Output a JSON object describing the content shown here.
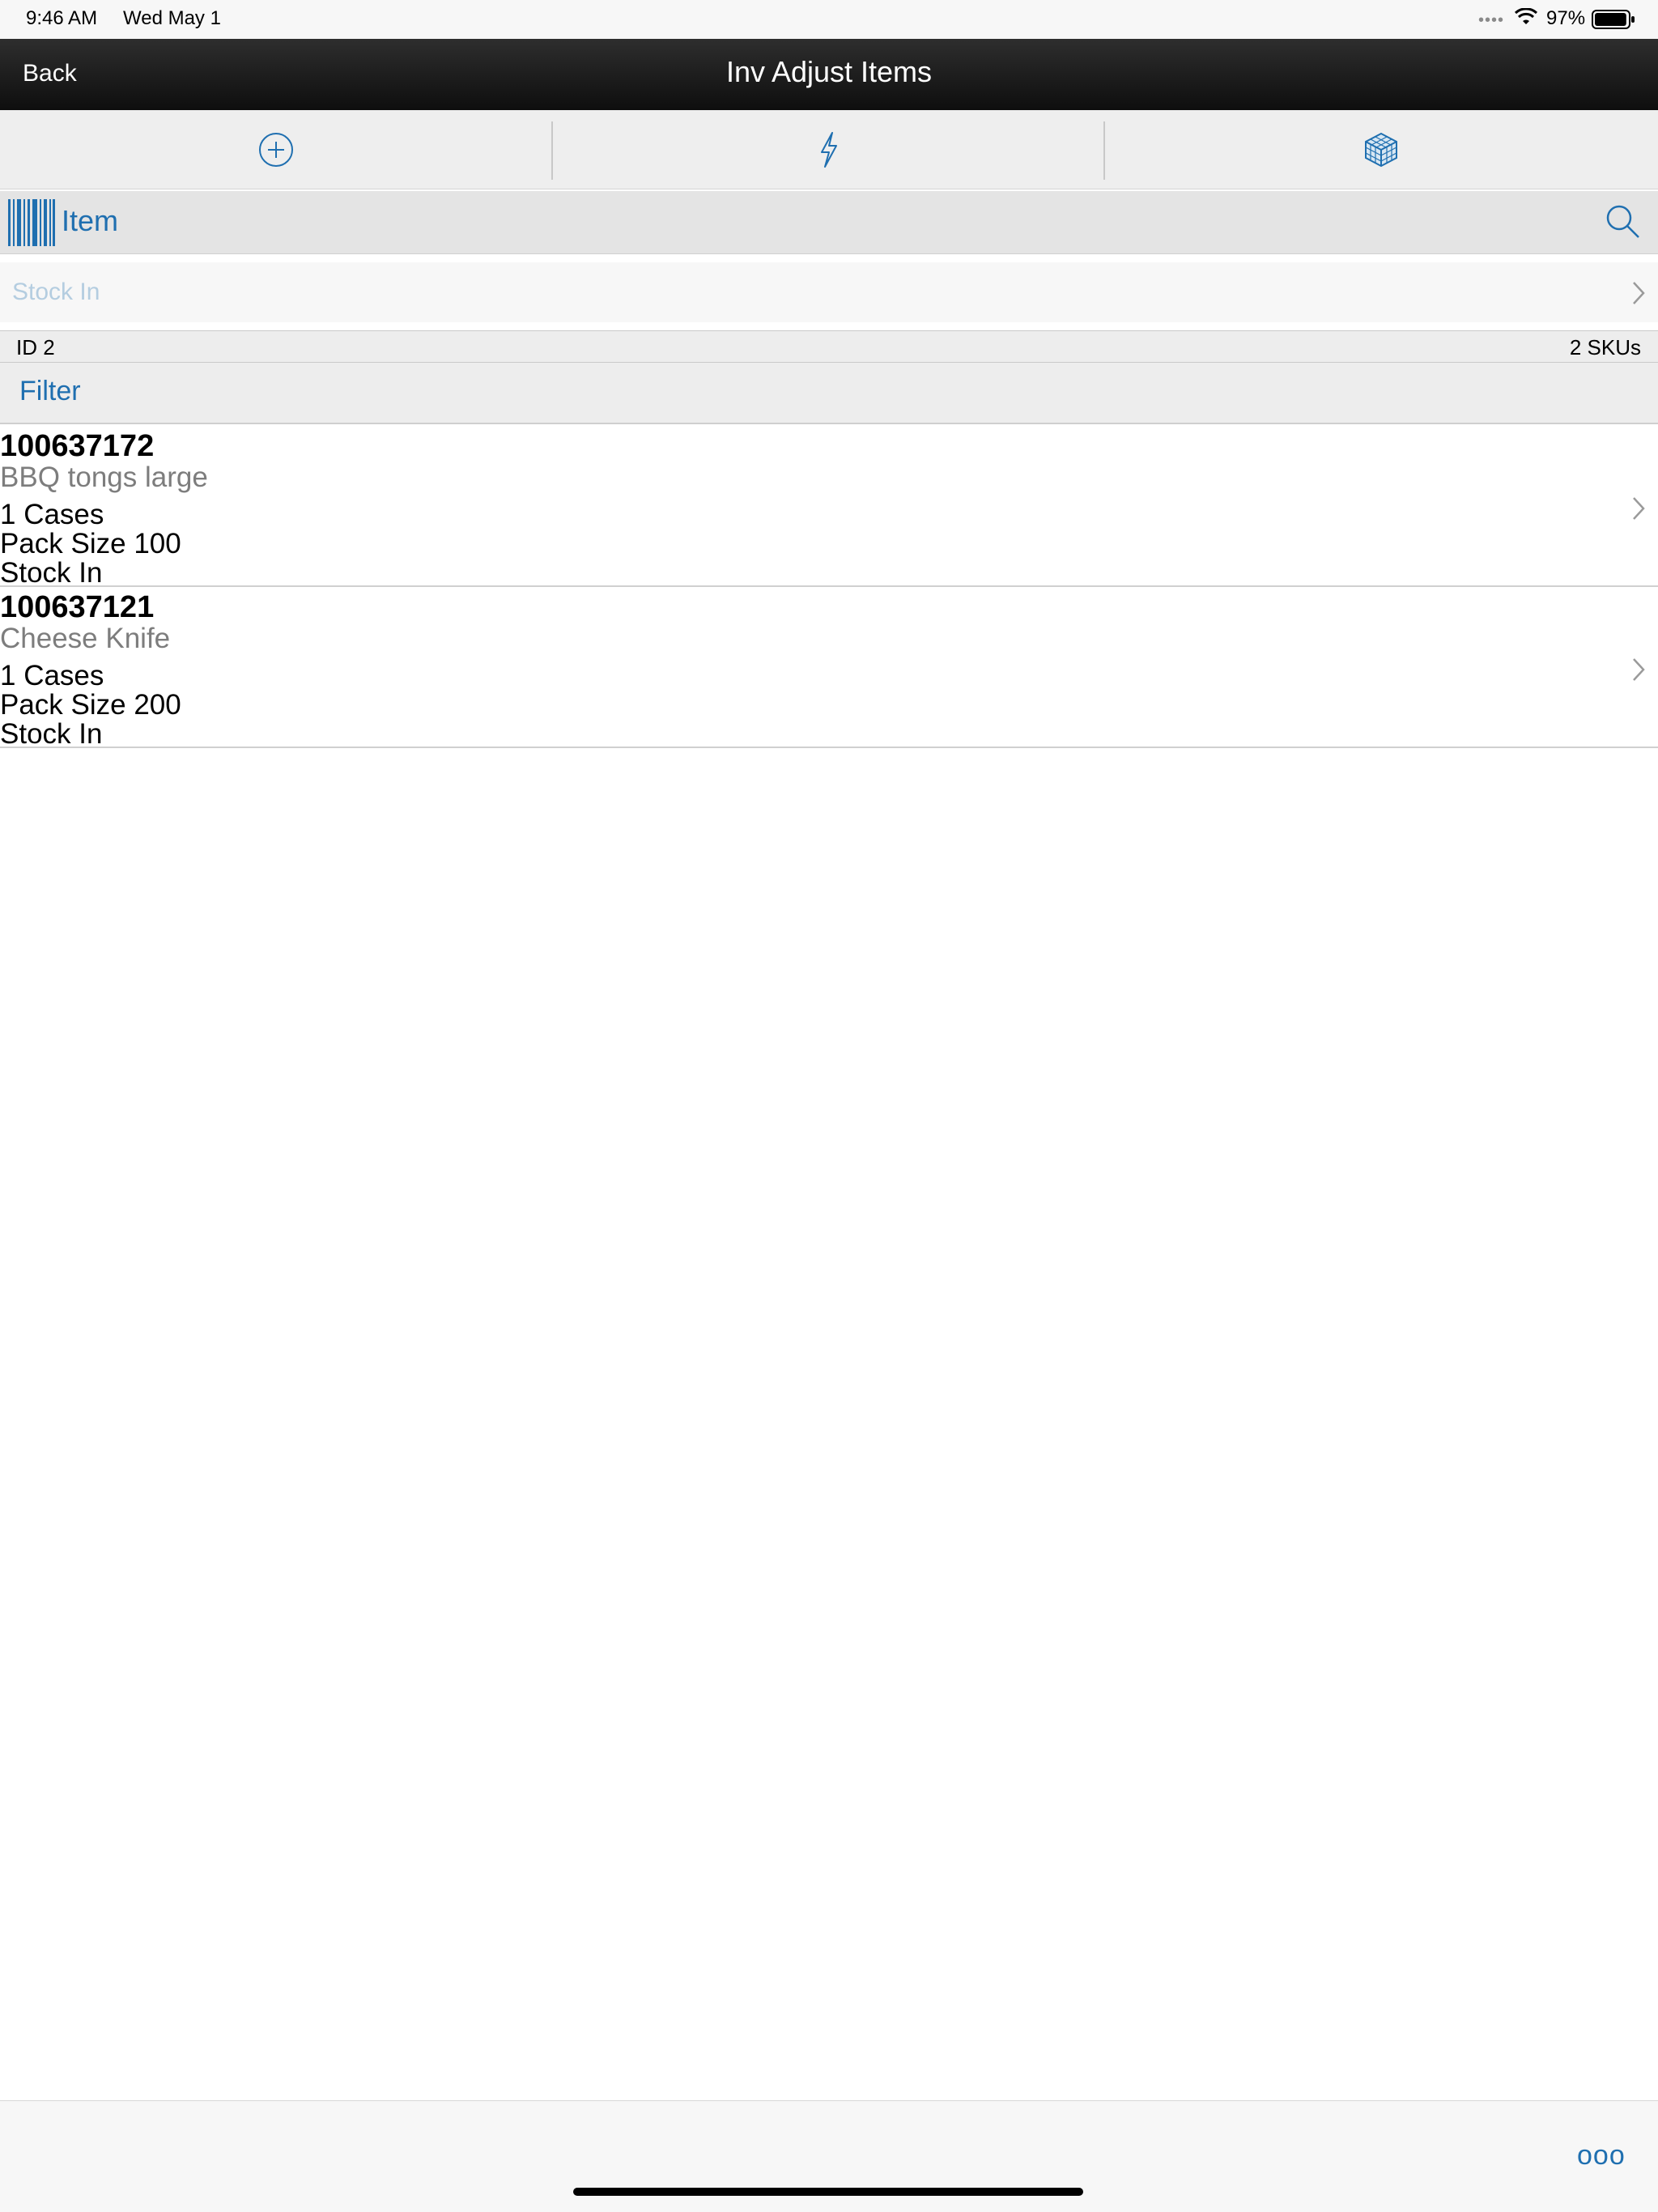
{
  "status_bar": {
    "time": "9:46 AM",
    "date": "Wed May 1",
    "battery_percent": "97%",
    "battery_level": 0.97
  },
  "nav": {
    "back_label": "Back",
    "title": "Inv Adjust Items"
  },
  "toolbar": {
    "buttons": [
      {
        "icon": "plus-circle-icon"
      },
      {
        "icon": "lightning-icon"
      },
      {
        "icon": "cube-icon"
      }
    ]
  },
  "search": {
    "label": "Item",
    "icon": "search-icon"
  },
  "reason": {
    "label": "Stock In"
  },
  "info": {
    "id_label": "ID 2",
    "sku_count": "2 SKUs"
  },
  "filter": {
    "label": "Filter"
  },
  "items": [
    {
      "sku": "100637172",
      "description": "BBQ tongs large",
      "quantity": "1 Cases",
      "pack_size": "Pack Size 100",
      "reason": "Stock In"
    },
    {
      "sku": "100637121",
      "description": "Cheese Knife",
      "quantity": "1 Cases",
      "pack_size": "Pack Size 200",
      "reason": "Stock In"
    }
  ],
  "bottom": {
    "more_label": "ooo"
  },
  "colors": {
    "accent": "#1f6fb0",
    "nav_bg": "#1a1a1a",
    "toolbar_bg": "#eeeeee"
  }
}
